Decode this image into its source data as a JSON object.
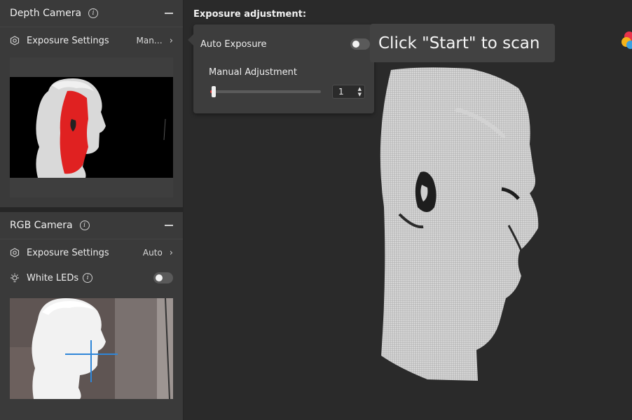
{
  "depth_camera": {
    "title": "Depth Camera",
    "exposure_label": "Exposure Settings",
    "exposure_value": "Man…"
  },
  "rgb_camera": {
    "title": "RGB Camera",
    "exposure_label": "Exposure Settings",
    "exposure_value": "Auto",
    "white_leds_label": "White LEDs",
    "white_leds_on": false
  },
  "main": {
    "exposure_adjustment_title": "Exposure adjustment:",
    "popover": {
      "auto_exposure_label": "Auto Exposure",
      "auto_exposure_on": false,
      "manual_adjustment_label": "Manual Adjustment",
      "manual_value": "1"
    },
    "toast": "Click \"Start\" to scan"
  },
  "icons": {
    "info": "info-icon",
    "collapse": "minus-icon",
    "exposure": "hexagon-settings-icon",
    "chevron": "chevron-right-icon",
    "led": "lightbulb-icon"
  },
  "colors": {
    "slider_fill": "#e23b3b",
    "depth_overlay": "#e00000",
    "crosshair": "#2f86d8"
  }
}
